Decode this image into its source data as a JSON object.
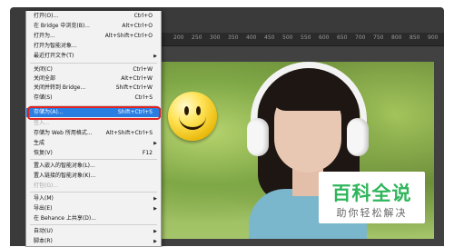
{
  "ruler": {
    "ticks": [
      "200",
      "250",
      "300",
      "350",
      "400",
      "450",
      "500",
      "550",
      "600",
      "650",
      "700",
      "750",
      "800",
      "850",
      "900"
    ]
  },
  "menu": {
    "items": [
      {
        "label": "打开(O)...",
        "shortcut": "Ctrl+O"
      },
      {
        "label": "在 Bridge 中浏览(B)...",
        "shortcut": "Alt+Ctrl+O"
      },
      {
        "label": "打开为...",
        "shortcut": "Alt+Shift+Ctrl+O"
      },
      {
        "label": "打开为智能对象..."
      },
      {
        "label": "最近打开文件(T)",
        "submenu": true
      },
      {
        "label": "关闭(C)",
        "shortcut": "Ctrl+W"
      },
      {
        "label": "关闭全部",
        "shortcut": "Alt+Ctrl+W"
      },
      {
        "label": "关闭并转到 Bridge...",
        "shortcut": "Shift+Ctrl+W"
      },
      {
        "label": "存储(S)",
        "shortcut": "Ctrl+S"
      },
      {
        "label": "存储为(A)...",
        "shortcut": "Shift+Ctrl+S",
        "highlighted": true
      },
      {
        "label": "签入...",
        "disabled": true
      },
      {
        "label": "存储为 Web 所用格式...",
        "shortcut": "Alt+Shift+Ctrl+S"
      },
      {
        "label": "生成",
        "submenu": true
      },
      {
        "label": "恢复(V)",
        "shortcut": "F12"
      },
      {
        "label": "置入嵌入的智能对象(L)..."
      },
      {
        "label": "置入链接的智能对象(K)..."
      },
      {
        "label": "打包(G)...",
        "disabled": true
      },
      {
        "label": "导入(M)",
        "submenu": true
      },
      {
        "label": "导出(E)",
        "submenu": true
      },
      {
        "label": "在 Behance 上共享(D)..."
      },
      {
        "label": "自动(U)",
        "submenu": true
      },
      {
        "label": "脚本(R)",
        "submenu": true
      }
    ]
  },
  "watermark": {
    "title": "百科全说",
    "subtitle": "助你轻松解决"
  },
  "colors": {
    "highlight": "#2a7de1",
    "callout": "#e0231f",
    "watermark_green": "#2fb55b"
  },
  "icons": {
    "canvas_sticker": "smiley-face-icon",
    "submenu_arrow": "chevron-right-icon"
  }
}
